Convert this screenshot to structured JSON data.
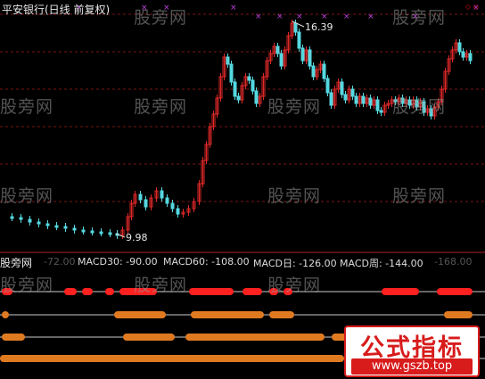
{
  "header": {
    "title": "平安银行(日线 前复权)",
    "diamond_icons": "◇◇"
  },
  "price_chart": {
    "high_label": "16.39",
    "low_label": "9.98",
    "top_marker": "×"
  },
  "macd_strip": {
    "logo": "股旁网",
    "items": [
      {
        "label": "-72.00",
        "color": "#555555"
      },
      {
        "label": "MACD30: -90.00",
        "color": "#dcdcdc"
      },
      {
        "label": "MACD60: -108.00",
        "color": "#dcdcdc"
      },
      {
        "label": "MACD日: -126.00",
        "color": "#dcdcdc"
      },
      {
        "label": "MACD周: -144.00",
        "color": "#dcdcdc"
      },
      {
        "label": "-168.00",
        "color": "#555555"
      }
    ]
  },
  "watermark": {
    "text": "股旁网"
  },
  "stamp": {
    "title": "公式指标",
    "url": "www.gszb.top"
  },
  "colors": {
    "up": "#e02828",
    "down": "#55d8e0",
    "grid": "#7a1414",
    "band_red": "#ff2020",
    "band_orange": "#e07a20",
    "marker": "#c040e0"
  }
}
